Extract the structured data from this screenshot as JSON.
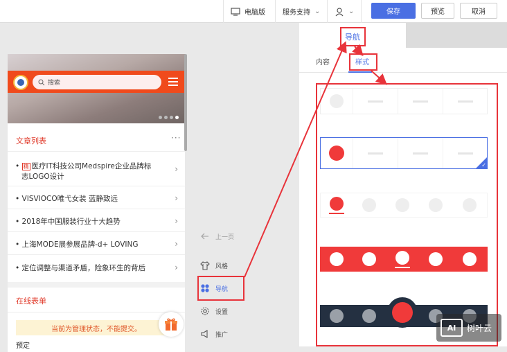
{
  "topbar": {
    "desktop_label": "电脑版",
    "service_label": "服务支持",
    "save_label": "保存",
    "preview_label": "预览",
    "cancel_label": "取消"
  },
  "phone": {
    "search_placeholder": "搜索",
    "article_section_title": "文章列表",
    "more_label": "···",
    "articles": [
      {
        "tag": "精",
        "title": "医疗IT科技公司Medspire企业品牌标",
        "title_line2": "志LOGO设计"
      },
      {
        "title": "VISVIOCO唯弋女装 蓝静致远"
      },
      {
        "title": "2018年中国服装行业十大趋势"
      },
      {
        "title": "上海MODE展参展品牌-d+ LOVING"
      },
      {
        "title": "定位调整与渠道矛盾，险象环生的背后"
      }
    ],
    "form_section_title": "在线表单",
    "admin_notice": "当前为管理状态，不能提交。",
    "partial_text": "预定"
  },
  "toolbox": {
    "prev_label": "上一页",
    "style_label": "风格",
    "nav_label": "导航",
    "settings_label": "设置",
    "promote_label": "推广"
  },
  "panel": {
    "title": "导航",
    "tab_content": "内容",
    "tab_style": "样式"
  },
  "watermark": {
    "logo": "AI",
    "text": "树叶云"
  },
  "colors": {
    "accent": "#4a6fe3",
    "red": "#f03a3a",
    "dark": "#243041"
  }
}
